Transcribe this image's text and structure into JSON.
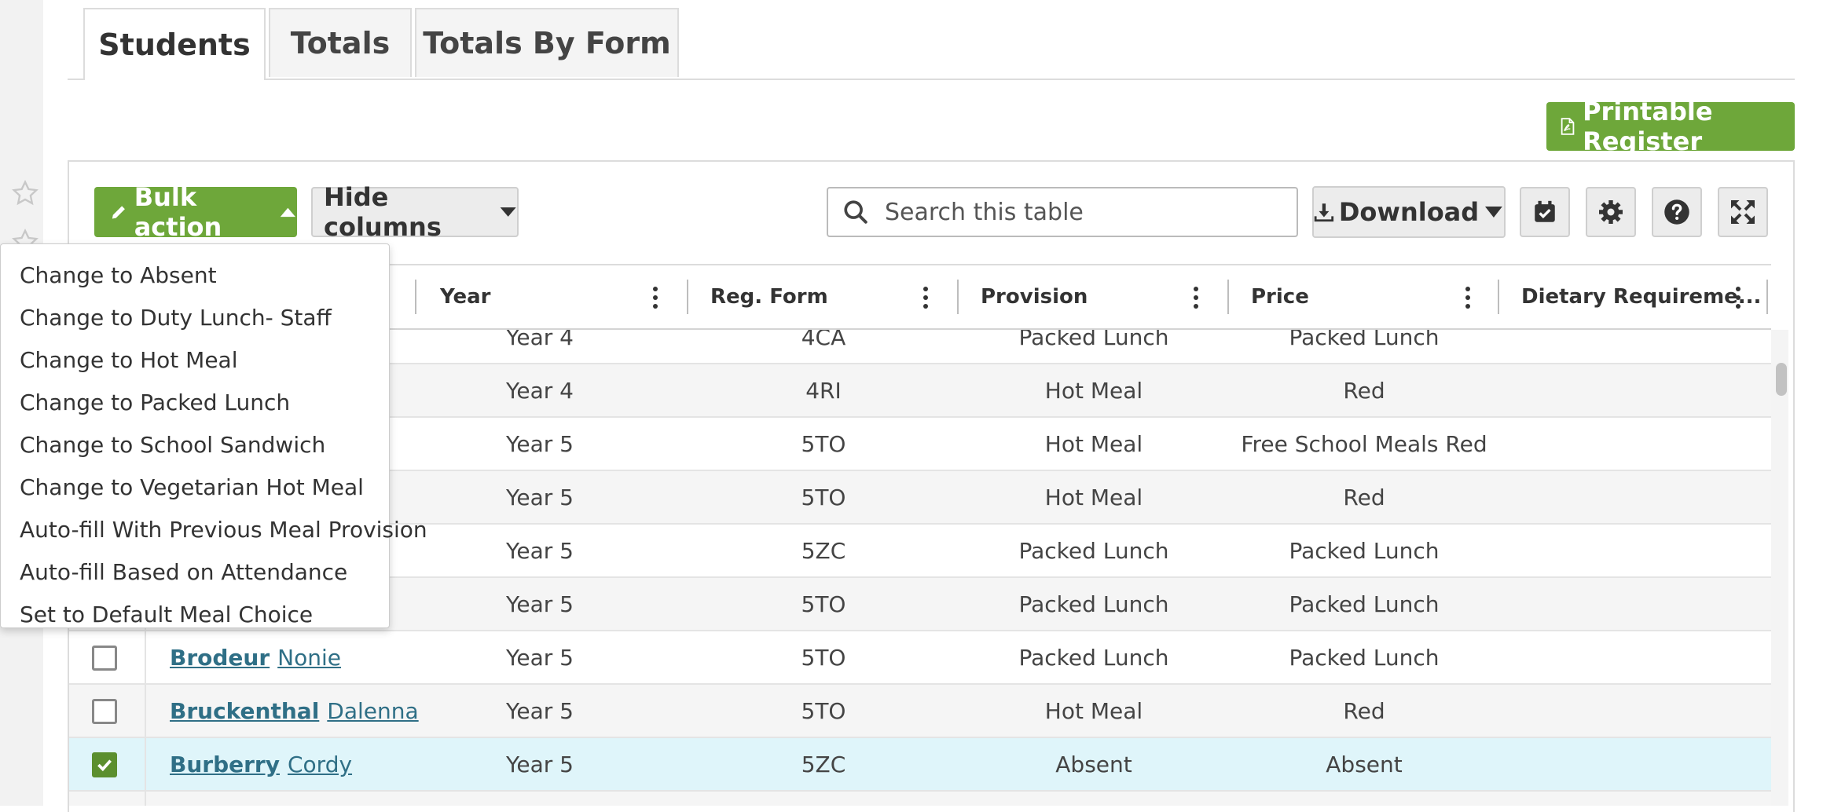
{
  "tabs": [
    {
      "label": "Students",
      "active": true
    },
    {
      "label": "Totals",
      "active": false
    },
    {
      "label": "Totals By Form",
      "active": false
    }
  ],
  "toolbar": {
    "printable_register": "Printable Register",
    "bulk_action": "Bulk action",
    "hide_columns": "Hide columns",
    "search_placeholder": "Search this table",
    "download": "Download",
    "icons": [
      "calendar-check-icon",
      "gear-icon",
      "help-icon",
      "expand-icon"
    ]
  },
  "bulk_menu": {
    "items": [
      "Change to Absent",
      "Change to Duty Lunch- Staff",
      "Change to Hot Meal",
      "Change to Packed Lunch",
      "Change to School Sandwich",
      "Change to Vegetarian Hot Meal",
      "Auto-fill With Previous Meal Provision",
      "Auto-fill Based on Attendance",
      "Set to Default Meal Choice"
    ]
  },
  "table": {
    "columns": [
      "Year",
      "Reg. Form",
      "Provision",
      "Price",
      "Dietary Requireme..."
    ],
    "rows": [
      {
        "last": "",
        "first": "",
        "year": "Year 4",
        "form": "4CA",
        "provision": "Packed Lunch",
        "price": "Packed Lunch",
        "checked": false
      },
      {
        "last": "",
        "first": "",
        "year": "Year 4",
        "form": "4RI",
        "provision": "Hot Meal",
        "price": "Red",
        "checked": false
      },
      {
        "last": "",
        "first": "",
        "year": "Year 5",
        "form": "5TO",
        "provision": "Hot Meal",
        "price": "Free School Meals Red",
        "checked": false
      },
      {
        "last": "",
        "first": "",
        "year": "Year 5",
        "form": "5TO",
        "provision": "Hot Meal",
        "price": "Red",
        "checked": false
      },
      {
        "last": "",
        "first": "",
        "year": "Year 5",
        "form": "5ZC",
        "provision": "Packed Lunch",
        "price": "Packed Lunch",
        "checked": false
      },
      {
        "last": "",
        "first": "",
        "year": "Year 5",
        "form": "5TO",
        "provision": "Packed Lunch",
        "price": "Packed Lunch",
        "checked": false
      },
      {
        "last": "Brodeur",
        "first": "Nonie",
        "year": "Year 5",
        "form": "5TO",
        "provision": "Packed Lunch",
        "price": "Packed Lunch",
        "checked": false
      },
      {
        "last": "Bruckenthal",
        "first": "Dalenna",
        "year": "Year 5",
        "form": "5TO",
        "provision": "Hot Meal",
        "price": "Red",
        "checked": false
      },
      {
        "last": "Burberry",
        "first": "Cordy",
        "year": "Year 5",
        "form": "5ZC",
        "provision": "Absent",
        "price": "Absent",
        "checked": true
      },
      {
        "last": "",
        "first": "",
        "year": "",
        "form": "",
        "provision": "",
        "price": "",
        "checked": false
      }
    ]
  },
  "colors": {
    "accent_green": "#6ea73a",
    "selected_row": "#dff5fa",
    "link": "#2f6f86"
  }
}
